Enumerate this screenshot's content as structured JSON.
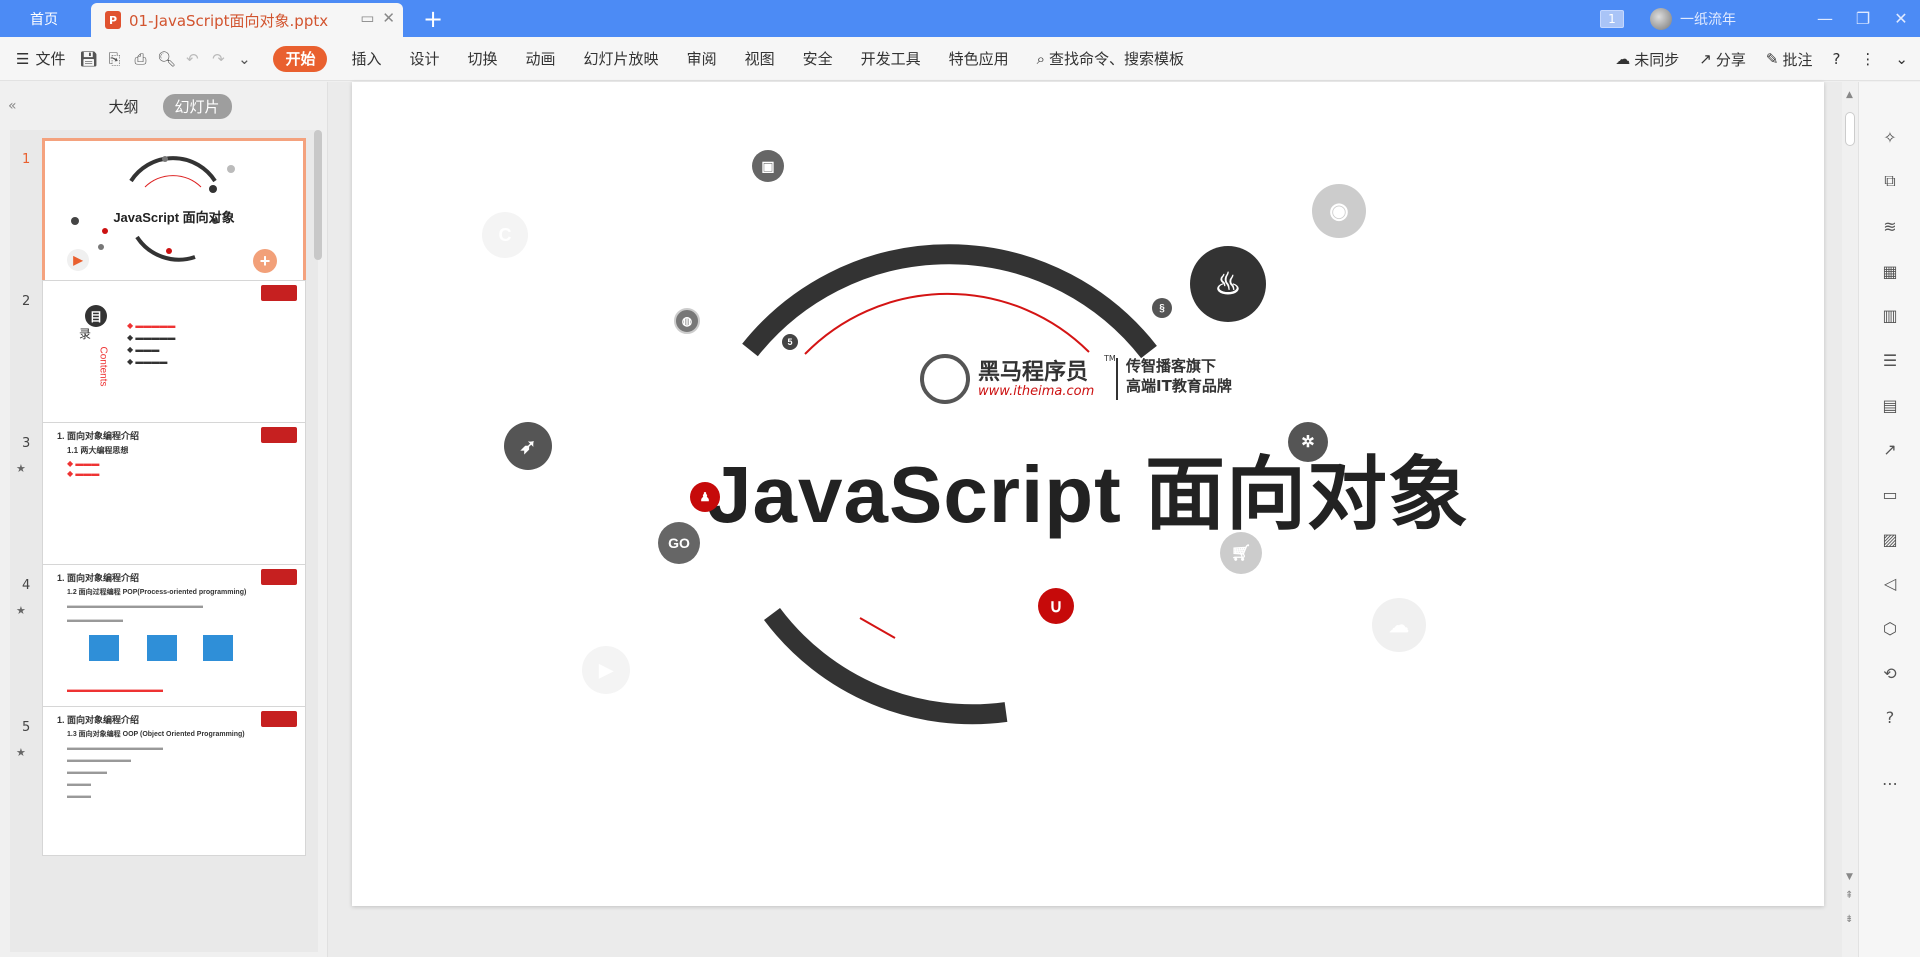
{
  "titlebar": {
    "home_tab": "首页",
    "doc_tab": "01-JavaScript面向对象.pptx",
    "doc_icon": "P",
    "new_tab": "+",
    "page_badge": "1",
    "user_name": "一纸流年"
  },
  "toolbar": {
    "file_label": "文件",
    "tabs": [
      "开始",
      "插入",
      "设计",
      "切换",
      "动画",
      "幻灯片放映",
      "审阅",
      "视图",
      "安全",
      "开发工具",
      "特色应用"
    ],
    "search_label": "查找命令、搜索模板",
    "sync_label": "未同步",
    "share_label": "分享",
    "annotate_label": "批注"
  },
  "left_panel": {
    "outline_tab": "大纲",
    "slides_tab": "幻灯片"
  },
  "thumbnails": [
    {
      "number": "1",
      "title": "JavaScript 面向对象"
    },
    {
      "number": "2",
      "heading_char_1": "目",
      "heading_char_2": "录",
      "side_text": "Contents"
    },
    {
      "number": "3",
      "heading": "1. 面向对象编程介绍",
      "sub": "1.1 两大编程思想"
    },
    {
      "number": "4",
      "heading": "1. 面向对象编程介绍",
      "sub": "1.2 面向过程编程 POP(Process-oriented programming)"
    },
    {
      "number": "5",
      "heading": "1. 面向对象编程介绍",
      "sub": "1.3 面向对象编程 OOP (Object Oriented Programming)"
    }
  ],
  "slide": {
    "title": "JavaScript 面向对象",
    "logo_name": "黑马程序员",
    "logo_tm": "TM",
    "logo_url": "www.itheima.com",
    "slogan_line1": "传智播客旗下",
    "slogan_line2": "高端IT教育品牌",
    "go_icon_text": "GO"
  },
  "colors": {
    "accent": "#e9602f",
    "titlebar": "#4c8bf5",
    "brand_red": "#c11111",
    "arc_dark": "#333333"
  }
}
